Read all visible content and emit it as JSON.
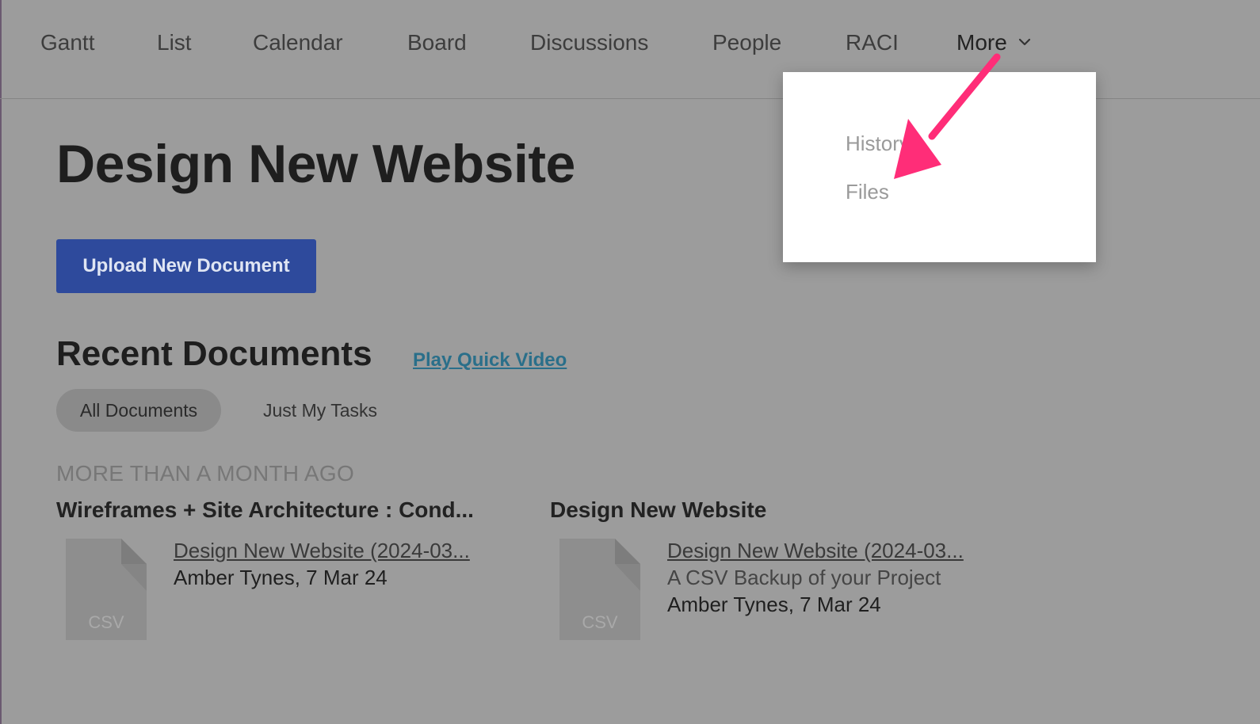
{
  "nav": {
    "items": [
      "Gantt",
      "List",
      "Calendar",
      "Board",
      "Discussions",
      "People",
      "RACI"
    ],
    "more_label": "More"
  },
  "dropdown": {
    "items": [
      "History",
      "Files"
    ]
  },
  "page": {
    "title": "Design New Website",
    "upload_button": "Upload New Document"
  },
  "recent": {
    "title": "Recent Documents",
    "video_link": "Play Quick Video",
    "filters": [
      "All Documents",
      "Just My Tasks"
    ],
    "active_filter": "All Documents",
    "group_label": "MORE THAN A MONTH AGO",
    "groups": [
      {
        "title": "Wireframes + Site Architecture : Cond...",
        "file": {
          "type_label": "CSV",
          "name": "Design New Website (2024-03...",
          "meta": "Amber Tynes, 7 Mar 24"
        }
      },
      {
        "title": "Design New Website",
        "file": {
          "type_label": "CSV",
          "name": "Design New Website (2024-03...",
          "description": "A CSV Backup of your Project",
          "meta": "Amber Tynes, 7 Mar 24"
        }
      }
    ]
  },
  "colors": {
    "overlay_background": "#9c9c9c",
    "button_blue": "#2e4a9c",
    "link_teal": "#2a6f8a",
    "annotation_arrow": "#ff2d78"
  },
  "icons": [
    "chevron-down-icon",
    "csv-file-icon",
    "annotation-arrow"
  ]
}
